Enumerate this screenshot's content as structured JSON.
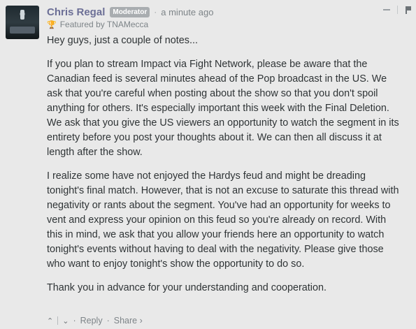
{
  "comment": {
    "author": "Chris Regal",
    "badge": "Moderator",
    "dot": "·",
    "time": "a minute ago",
    "featured": "Featured by TNAMecca",
    "paragraphs": [
      "Hey guys, just a couple of notes...",
      "If you plan to stream Impact via Fight Network, please be aware that the Canadian feed is several minutes ahead of the Pop broadcast in the US. We ask that you're careful when posting about the show so that you don't spoil anything for others. It's especially important this week with the Final Deletion. We ask that you give the US viewers an opportunity to watch the segment in its entirety before you post your thoughts about it. We can then all discuss it at length after the show.",
      "I realize some have not enjoyed the Hardys feud and might be dreading tonight's final match. However, that is not an excuse to saturate this thread with negativity or rants about the segment. You've had an opportunity for weeks to vent and express your opinion on this feud so you're already on record. With this in mind, we ask that you allow your friends here an opportunity to watch tonight's events without having to deal with the negativity. Please give those who want to enjoy tonight's show the opportunity to do so.",
      "Thank you in advance for your understanding and cooperation."
    ]
  },
  "footer": {
    "upvote": "⌃",
    "downvote": "⌄",
    "dot": "·",
    "reply": "Reply",
    "share": "Share ›"
  },
  "icons": {
    "trophy": "trophy-icon",
    "flag": "flag-icon",
    "minimize": "minimize-icon"
  }
}
